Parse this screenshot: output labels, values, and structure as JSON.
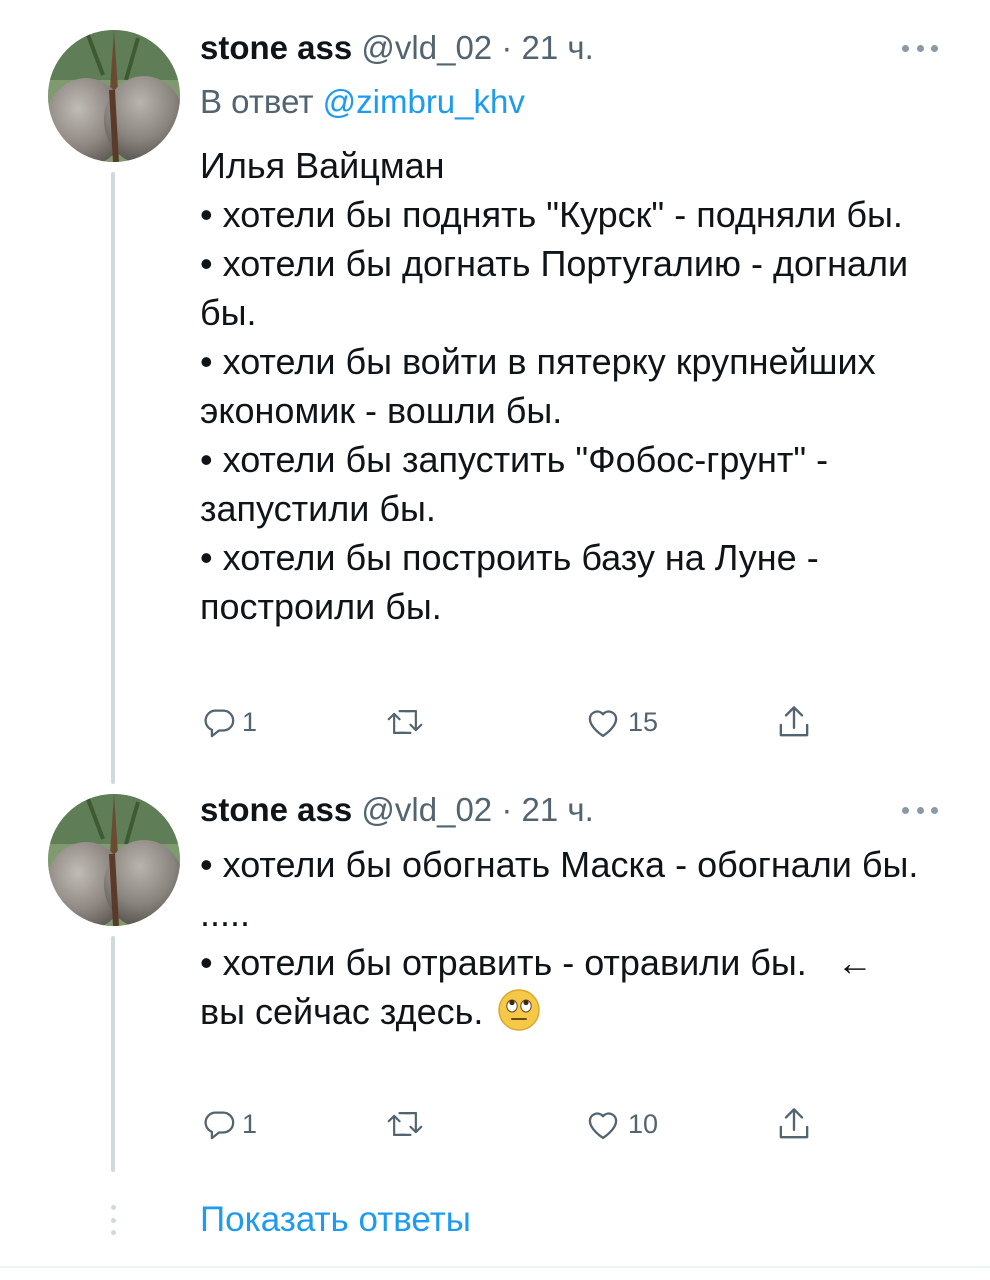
{
  "tweets": [
    {
      "author_name": "stone ass",
      "handle": "@vld_02",
      "separator": "·",
      "time": "21 ч.",
      "reply_prefix": "В ответ",
      "reply_mention": "@zimbru_khv",
      "lines": [
        "Илья Вайцман",
        "• хотели бы поднять \"Курск\" - подняли бы.",
        "• хотели бы догнать Португалию - догнали бы.",
        "• хотели бы войти в пятерку крупнейших экономик - вошли бы.",
        "• хотели бы запустить \"Фобос-грунт\" - запустили бы.",
        "• хотели бы построить базу на Луне - построили бы."
      ],
      "reply_count": "1",
      "like_count": "15",
      "icons": [
        "reply-icon",
        "retweet-icon",
        "heart-icon",
        "share-icon"
      ]
    },
    {
      "author_name": "stone ass",
      "handle": "@vld_02",
      "separator": "·",
      "time": "21 ч.",
      "lines": [
        "• хотели бы обогнать Маска - обогнали бы.",
        ".....",
        "• хотели бы отравить - отравили бы.   ←"
      ],
      "last_line_text": "вы сейчас здесь.",
      "last_line_emoji": "face-with-rolling-eyes",
      "reply_count": "1",
      "like_count": "10",
      "icons": [
        "reply-icon",
        "retweet-icon",
        "heart-icon",
        "share-icon"
      ]
    }
  ],
  "show_replies_label": "Показать ответы",
  "colors": {
    "accent": "#1d9bf0",
    "secondary_text": "#536471",
    "thread_line": "#cfd9de"
  }
}
